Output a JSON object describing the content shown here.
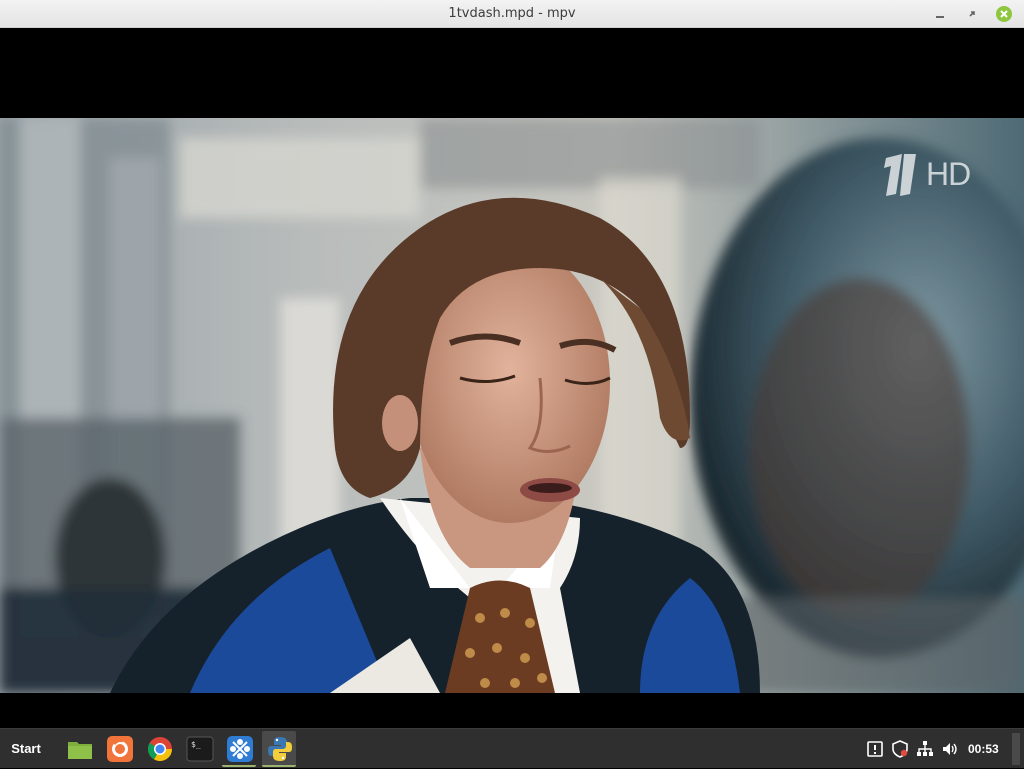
{
  "window": {
    "title": "1tvdash.mpd - mpv",
    "minimize_icon": "minimize-icon",
    "maximize_icon": "maximize-icon",
    "close_icon": "close-icon"
  },
  "video": {
    "channel_logo": "1 HD",
    "logo_text": "HD"
  },
  "taskbar": {
    "start_label": "Start",
    "apps": [
      {
        "name": "files",
        "icon": "folder-icon"
      },
      {
        "name": "firefox",
        "icon": "firefox-icon"
      },
      {
        "name": "chrome",
        "icon": "chrome-icon"
      },
      {
        "name": "terminal",
        "icon": "terminal-icon"
      },
      {
        "name": "network-app",
        "icon": "app-icon"
      },
      {
        "name": "python",
        "icon": "python-icon"
      }
    ],
    "tray": [
      "update-icon",
      "shield-icon",
      "network-icon",
      "volume-icon"
    ],
    "clock": "00:53"
  },
  "colors": {
    "taskbar_bg": "#2f2f2f",
    "accent": "#9bb36e",
    "close_button": "#8ec63f"
  }
}
